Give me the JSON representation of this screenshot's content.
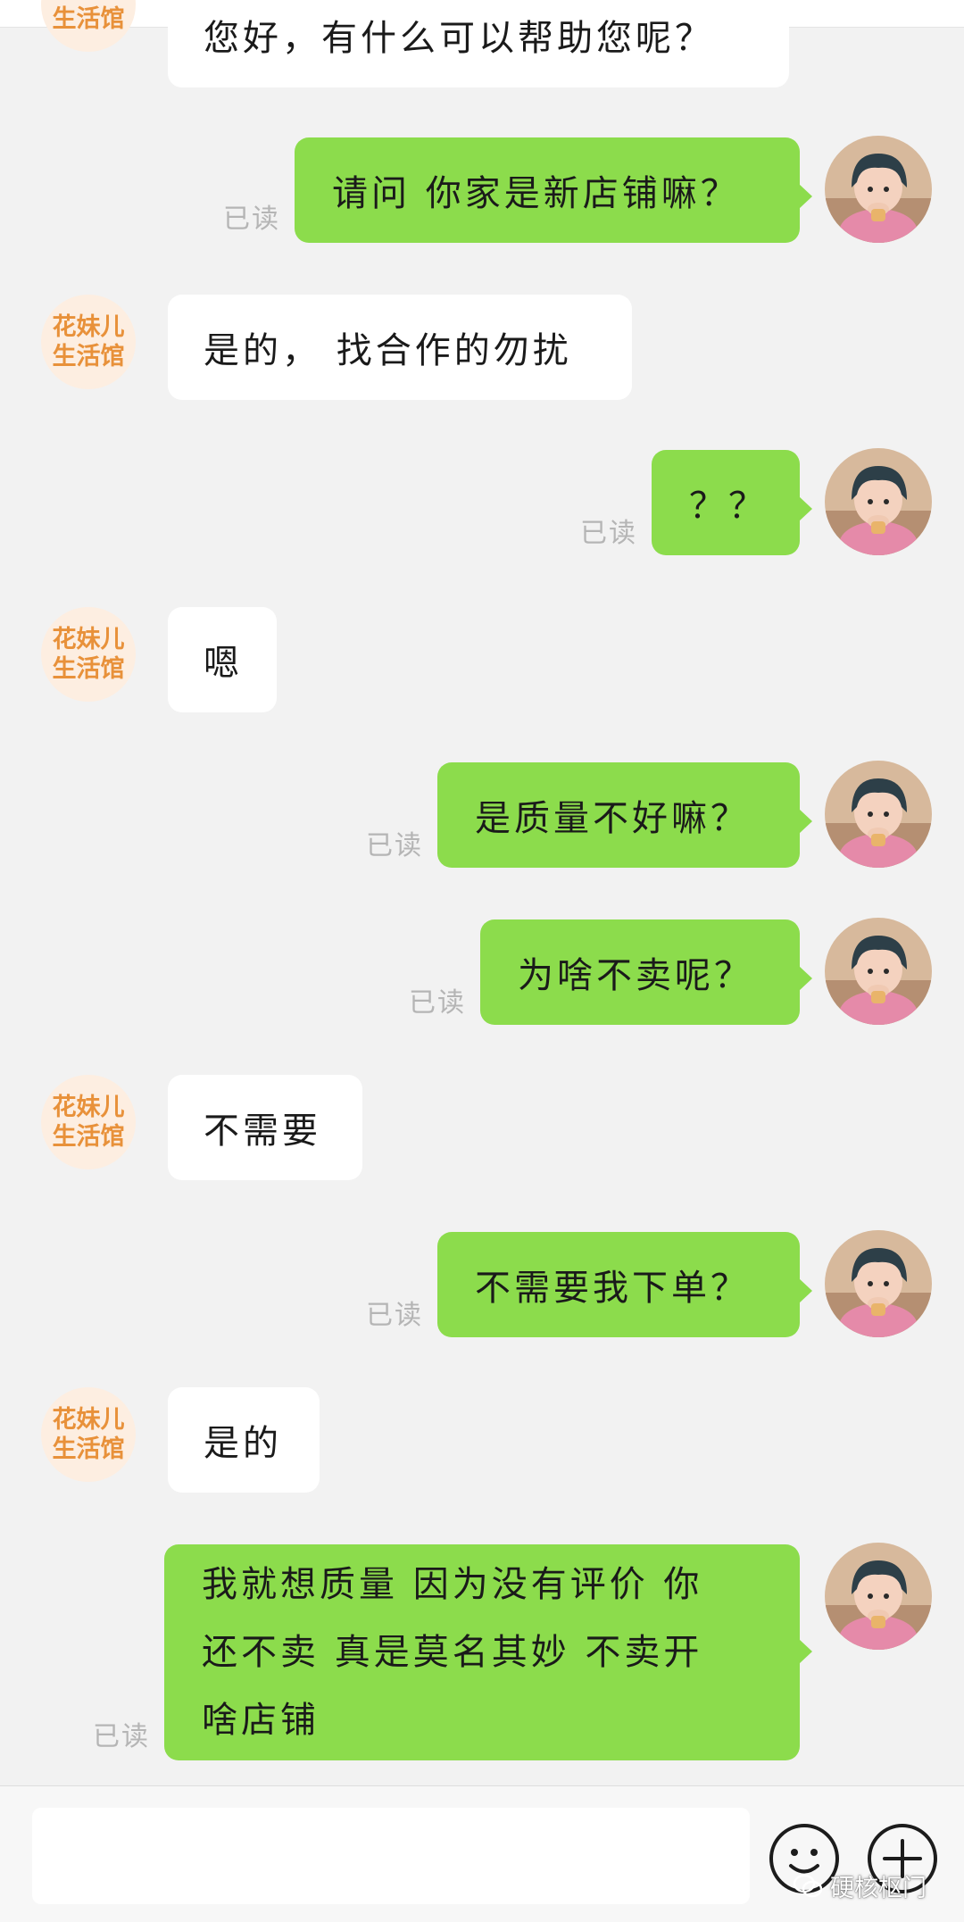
{
  "shop": {
    "name_line1": "花妹儿",
    "name_line2": "生活馆",
    "brand_color": "#e8913a"
  },
  "read_label": "已读",
  "colors": {
    "outgoing_bubble": "#8cdc4c",
    "incoming_bubble": "#ffffff",
    "background": "#f2f2f2"
  },
  "messages": [
    {
      "from": "shop",
      "text": "您好，有什么可以帮助您呢？"
    },
    {
      "from": "user",
      "text": "请问 你家是新店铺嘛？",
      "status": "已读"
    },
    {
      "from": "shop",
      "text": "是的， 找合作的勿扰"
    },
    {
      "from": "user",
      "text": "？？",
      "status": "已读"
    },
    {
      "from": "shop",
      "text": "嗯"
    },
    {
      "from": "user",
      "text": "是质量不好嘛？",
      "status": "已读"
    },
    {
      "from": "user",
      "text": "为啥不卖呢？",
      "status": "已读"
    },
    {
      "from": "shop",
      "text": "不需要"
    },
    {
      "from": "user",
      "text": "不需要我下单？",
      "status": "已读"
    },
    {
      "from": "shop",
      "text": "是的"
    },
    {
      "from": "user",
      "lines": [
        "我就想质量 因为没有评价 你",
        "还不卖 真是莫名其妙 不卖开",
        "啥店铺"
      ],
      "status": "已读"
    }
  ],
  "input_bar": {
    "placeholder": "",
    "emoji_icon": "smiley-face-icon",
    "add_icon": "plus-icon"
  },
  "watermark": {
    "text": "硬核枢门",
    "icon": "wechat-channel-icon"
  }
}
